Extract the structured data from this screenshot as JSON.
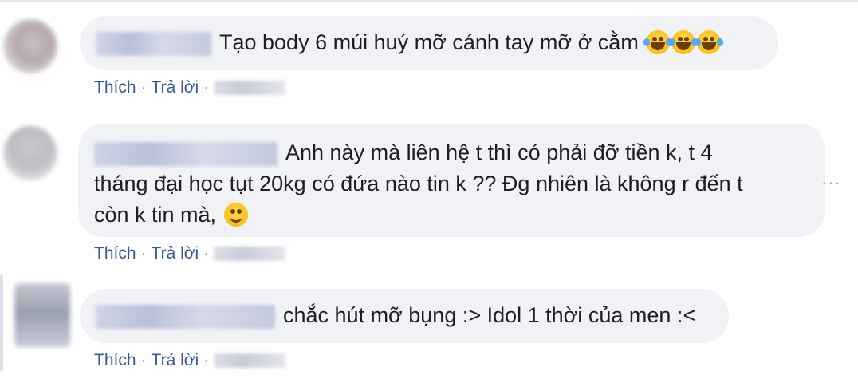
{
  "comments": [
    {
      "text": "Tạo body 6 múi huý mỡ cánh tay mỡ ở cằm",
      "emojis": [
        "laughing-tears",
        "laughing-tears",
        "laughing-tears"
      ]
    },
    {
      "text_lines": [
        "Anh này mà liên hệ t thì có phải đỡ tiền k, t 4",
        "tháng đại học tụt 20kg có đứa nào tin k ?? Đg nhiên là không r đến t",
        "còn k tin mà, "
      ],
      "emojis": [
        "smiling-face"
      ]
    },
    {
      "text": "chắc hút mỡ bụng :> Idol 1 thời của men :<",
      "emojis": []
    }
  ],
  "actions": {
    "like_label": "Thích",
    "reply_label": "Trả lời",
    "separator": "·"
  },
  "more_label": "···",
  "colors": {
    "link": "#385898",
    "bubble": "#f0f2f5",
    "text": "#1c1e21"
  }
}
